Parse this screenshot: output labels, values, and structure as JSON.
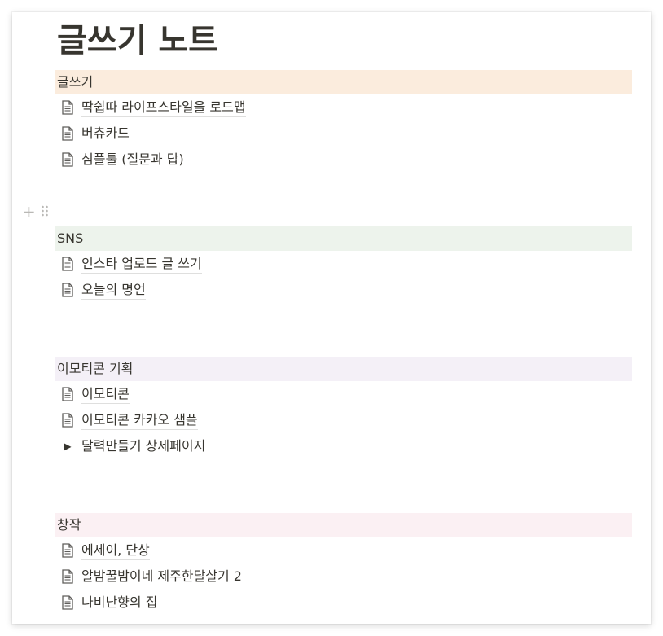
{
  "page": {
    "title": "글쓰기 노트"
  },
  "sections": [
    {
      "header": "글쓰기",
      "color": "#fbecdd",
      "items": [
        {
          "label": "딱쉽따 라이프스타일을 로드맵",
          "icon": "page-icon"
        },
        {
          "label": "버츄카드",
          "icon": "page-icon"
        },
        {
          "label": "심플툴 (질문과 답)",
          "icon": "page-icon"
        }
      ]
    },
    {
      "header": "SNS",
      "color": "#edf3ec",
      "items": [
        {
          "label": "인스타 업로드 글 쓰기",
          "icon": "page-icon"
        },
        {
          "label": "오늘의 명언",
          "icon": "page-icon"
        }
      ]
    },
    {
      "header": "이모티콘 기획",
      "color": "#f4f0f7",
      "items": [
        {
          "label": "이모티콘",
          "icon": "page-icon"
        },
        {
          "label": "이모티콘 카카오 샘플",
          "icon": "page-icon"
        }
      ],
      "toggle": {
        "label": "달력만들기 상세페이지",
        "icon": "triangle-right-icon"
      }
    },
    {
      "header": "창작",
      "color": "#fbf0f3",
      "items": [
        {
          "label": "에세이, 단상",
          "icon": "page-icon"
        },
        {
          "label": "알밤꿀밤이네 제주한달살기 2",
          "icon": "page-icon"
        },
        {
          "label": "나비난향의 집",
          "icon": "page-icon"
        }
      ]
    }
  ],
  "block_handle": {
    "add_icon": "plus-icon",
    "drag_icon": "drag-handle-icon"
  }
}
